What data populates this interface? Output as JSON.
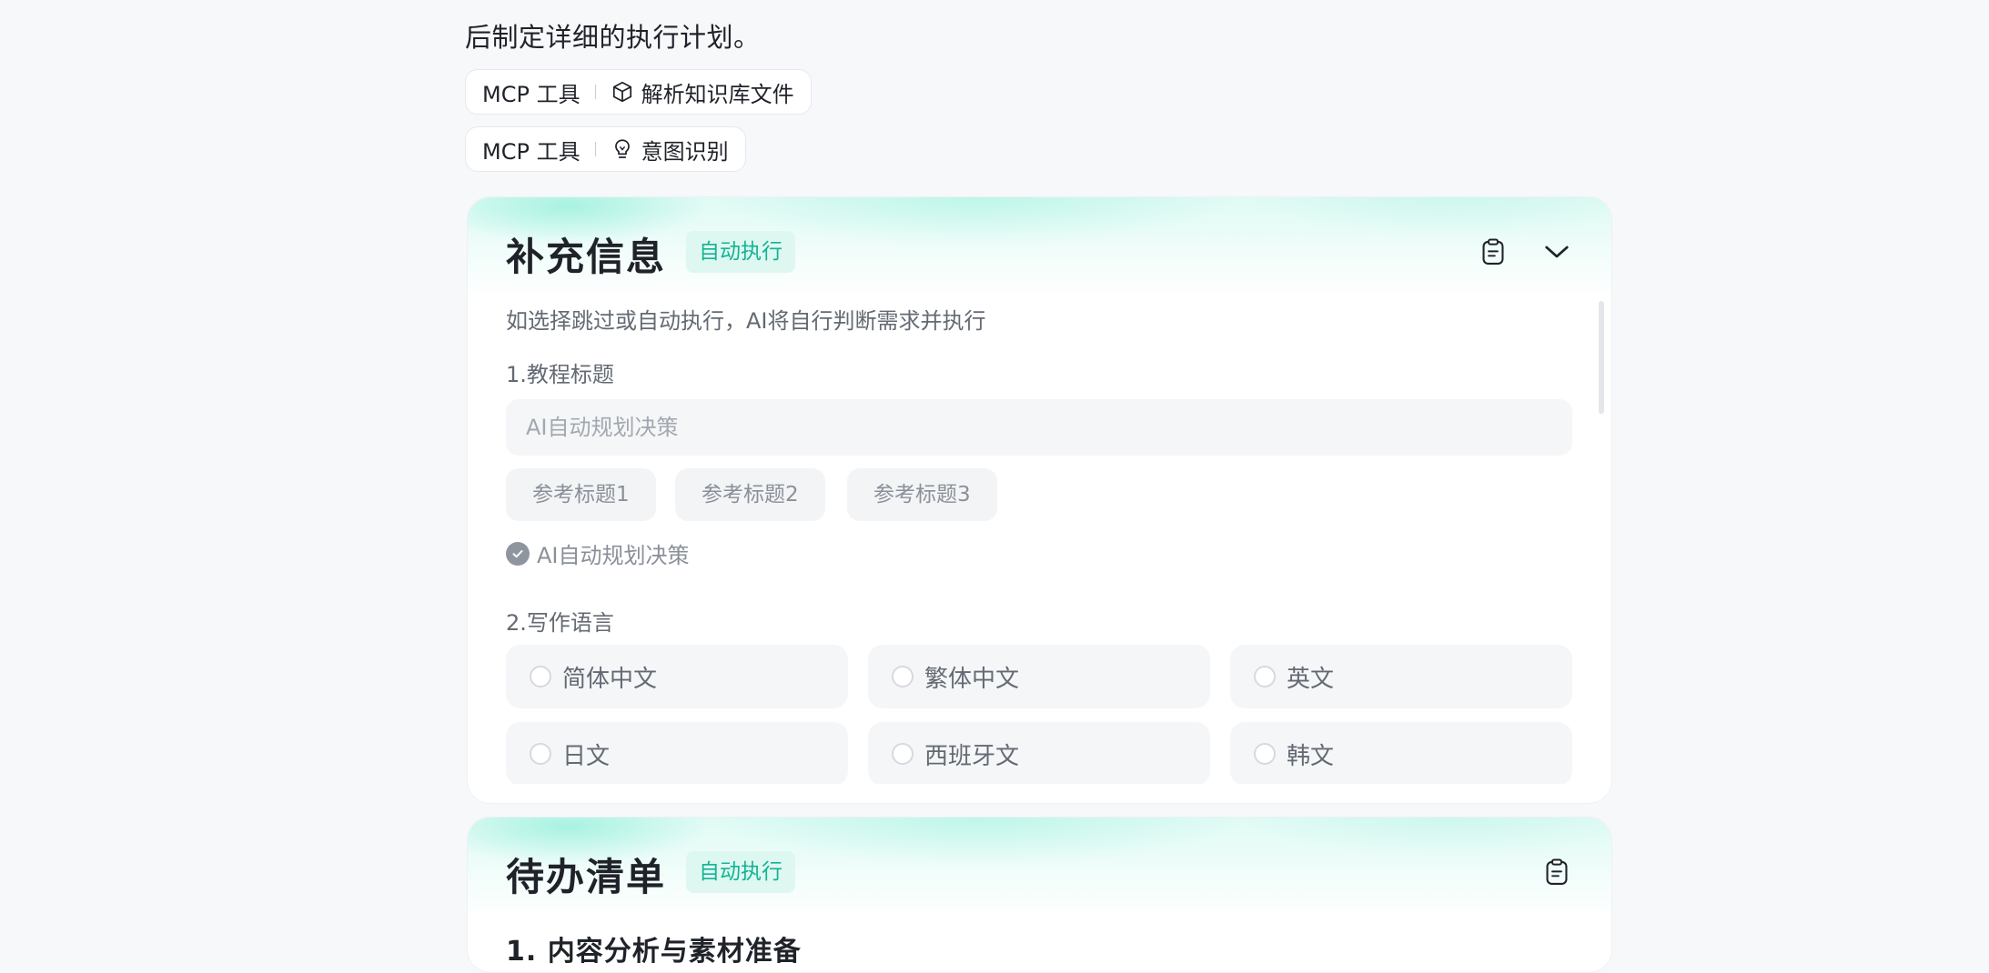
{
  "intro_text": "后制定详细的执行计划。",
  "tool_calls": [
    {
      "type_label": "MCP 工具",
      "icon": "cube-icon",
      "name": "解析知识库文件"
    },
    {
      "type_label": "MCP 工具",
      "icon": "lightbulb-icon",
      "name": "意图识别"
    }
  ],
  "info_card": {
    "title": "补充信息",
    "badge": "自动执行",
    "description": "如选择跳过或自动执行，AI将自行判断需求并执行",
    "q1": {
      "label": "1.教程标题",
      "placeholder": "AI自动规划决策",
      "value": "",
      "suggestions": [
        "参考标题1",
        "参考标题2",
        "参考标题3"
      ],
      "auto_label": "AI自动规划决策"
    },
    "q2": {
      "label": "2.写作语言",
      "options": [
        "简体中文",
        "繁体中文",
        "英文",
        "日文",
        "西班牙文",
        "韩文"
      ]
    }
  },
  "todo_card": {
    "title": "待办清单",
    "badge": "自动执行",
    "first_item": "1. 内容分析与素材准备"
  },
  "colors": {
    "accent": "#14b394",
    "badge_bg": "#dcf8f0",
    "page_bg": "#f7f8fa"
  }
}
